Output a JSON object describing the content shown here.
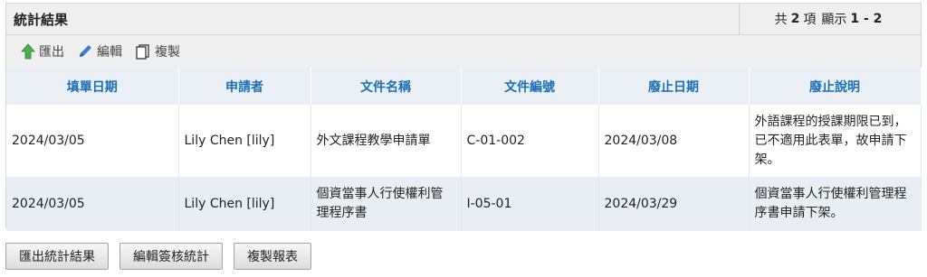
{
  "panel": {
    "title": "統計結果",
    "pager": {
      "total_prefix": "共",
      "total": "2",
      "total_suffix": "項",
      "shown_prefix": "顯示",
      "range": "1 - 2"
    }
  },
  "toolbar": {
    "export_label": "匯出",
    "edit_label": "編輯",
    "copy_label": "複製"
  },
  "table": {
    "headers": [
      "填單日期",
      "申請者",
      "文件名稱",
      "文件編號",
      "廢止日期",
      "廢止說明"
    ],
    "rows": [
      [
        "2024/03/05",
        "Lily Chen [lily]",
        "外文課程教學申請單",
        "C-01-002",
        "2024/03/08",
        "外語課程的授課期限已到，已不適用此表單，故申請下架。"
      ],
      [
        "2024/03/05",
        "Lily Chen [lily]",
        "個資當事人行使權利管理程序書",
        "I-05-01",
        "2024/03/29",
        "個資當事人行使權利管理程序書申請下架。"
      ]
    ]
  },
  "buttons": {
    "export_result": "匯出統計結果",
    "edit_stats": "編輯簽核統計",
    "copy_report": "複製報表"
  },
  "colors": {
    "header_text": "#1b6fb3",
    "export_icon": "#4caf50",
    "edit_icon": "#3a7bd5"
  }
}
